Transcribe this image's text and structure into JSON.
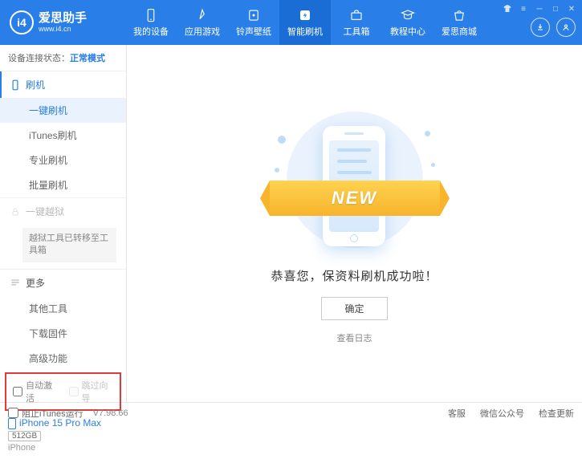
{
  "app": {
    "name": "爱思助手",
    "url": "www.i4.cn",
    "logo_letter": "i4"
  },
  "nav": [
    {
      "label": "我的设备",
      "icon": "device"
    },
    {
      "label": "应用游戏",
      "icon": "apps"
    },
    {
      "label": "铃声壁纸",
      "icon": "ringtone"
    },
    {
      "label": "智能刷机",
      "icon": "flash",
      "active": true
    },
    {
      "label": "工具箱",
      "icon": "toolbox"
    },
    {
      "label": "教程中心",
      "icon": "tutorial"
    },
    {
      "label": "爱思商城",
      "icon": "store"
    }
  ],
  "status": {
    "label": "设备连接状态：",
    "value": "正常模式"
  },
  "sidebar": {
    "flash": {
      "title": "刷机",
      "items": [
        "一键刷机",
        "iTunes刷机",
        "专业刷机",
        "批量刷机"
      ],
      "selected": 0
    },
    "jailbreak": {
      "title": "一键越狱",
      "note": "越狱工具已转移至工具箱"
    },
    "more": {
      "title": "更多",
      "items": [
        "其他工具",
        "下载固件",
        "高级功能"
      ]
    }
  },
  "options": {
    "auto_activate": "自动激活",
    "skip_guide": "跳过向导"
  },
  "device": {
    "name": "iPhone 15 Pro Max",
    "storage": "512GB",
    "type": "iPhone"
  },
  "main": {
    "ribbon": "NEW",
    "message": "恭喜您，保资料刷机成功啦！",
    "ok": "确定",
    "view_log": "查看日志"
  },
  "footer": {
    "block_itunes": "阻止iTunes运行",
    "version": "V7.98.66",
    "links": [
      "客服",
      "微信公众号",
      "检查更新"
    ]
  }
}
